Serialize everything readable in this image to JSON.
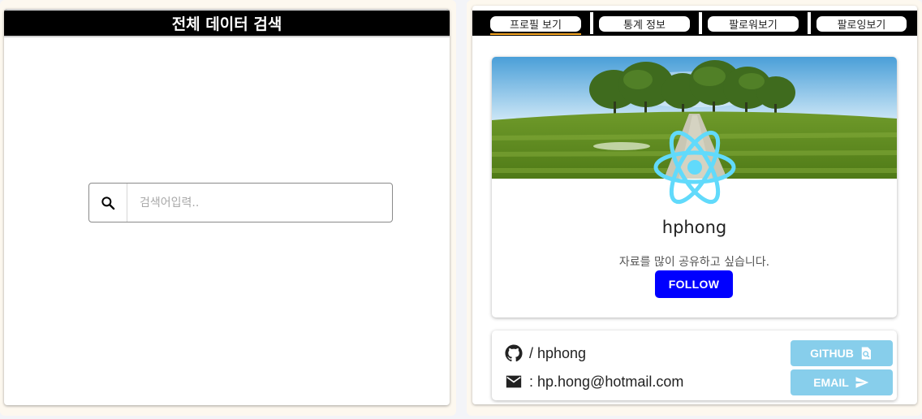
{
  "search_panel": {
    "title": "전체 데이터 검색",
    "search": {
      "placeholder": "검색어입력..",
      "value": "",
      "icon": "search-icon"
    }
  },
  "profile_panel": {
    "tabs": [
      {
        "label": "프로필 보기",
        "active": true
      },
      {
        "label": "통계 정보",
        "active": false
      },
      {
        "label": "팔로워보기",
        "active": false
      },
      {
        "label": "팔로잉보기",
        "active": false
      }
    ],
    "profile": {
      "username": "hphong",
      "bio": "자료를 많이 공유하고 싶습니다.",
      "follow_label": "FOLLOW",
      "avatar_icon": "react-logo-icon",
      "banner": "grass-field-trees-banner"
    },
    "contact": {
      "github_text": "/ hphong",
      "email_text": ": hp.hong@hotmail.com",
      "github_button": "GITHUB",
      "email_button": "EMAIL",
      "icons": [
        "github-icon",
        "mail-icon",
        "page-search-icon",
        "send-icon"
      ]
    }
  },
  "colors": {
    "header_bg": "#000000",
    "follow_button": "#0000ff",
    "contact_button": "#87ceeb",
    "react_logo": "#61dafb",
    "panel_bg": "#fdf8ef"
  }
}
